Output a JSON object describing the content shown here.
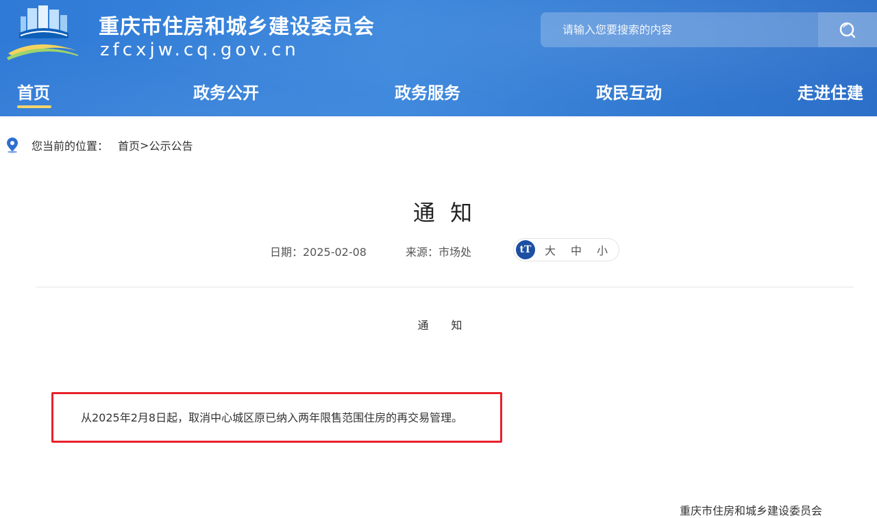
{
  "header": {
    "site_title": "重庆市住房和城乡建设委员会",
    "domain": "zfcxjw.cq.gov.cn",
    "search": {
      "placeholder": "请输入您要搜索的内容",
      "icon": "search-icon"
    },
    "colors": {
      "header_bg": "#2f7ad6",
      "nav_active_underline": "#f5d56a"
    }
  },
  "nav": {
    "items": [
      {
        "label": "首页",
        "active": true
      },
      {
        "label": "政务公开",
        "active": false
      },
      {
        "label": "政务服务",
        "active": false
      },
      {
        "label": "政民互动",
        "active": false
      },
      {
        "label": "走进住建",
        "active": false
      }
    ]
  },
  "breadcrumb": {
    "icon": "location-pin-icon",
    "label": "您当前的位置：",
    "home": "首页",
    "separator": ">",
    "current": "公示公告"
  },
  "article": {
    "title": "通 知",
    "date_text": "日期：2025-02-08",
    "source_text": "来源：市场处",
    "font_size": {
      "icon": "text-size-icon",
      "icon_text": "tT",
      "options": [
        "大",
        "中",
        "小"
      ]
    },
    "body_heading": "通 知",
    "notice": "从2025年2月8日起，取消中心城区原已纳入两年限售范围住房的再交易管理。",
    "highlight_color": "#e8202a",
    "signature": "重庆市住房和城乡建设委员会"
  }
}
